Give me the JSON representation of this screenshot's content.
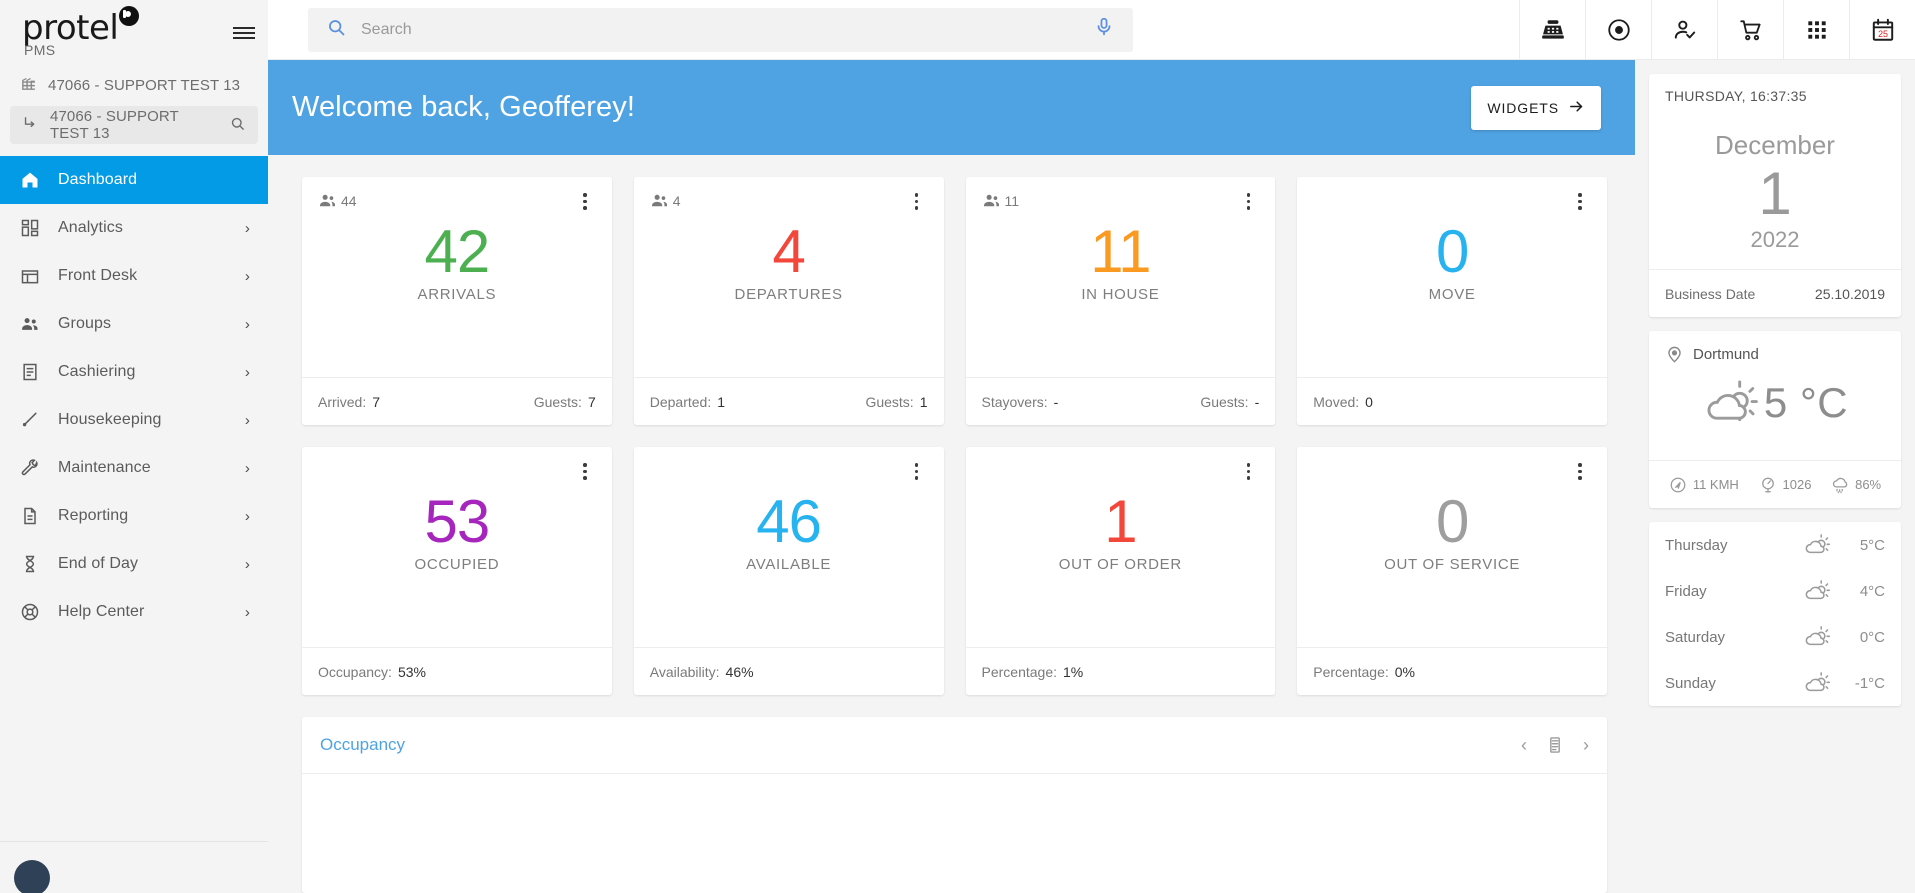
{
  "brand": {
    "name": "protel",
    "sub": "PMS",
    "dot_icon": "protel-mark-icon"
  },
  "property": {
    "parent": "47066 - SUPPORT TEST 13",
    "selected": "47066 - SUPPORT TEST 13"
  },
  "sidebar": {
    "items": [
      {
        "label": "Dashboard",
        "icon": "home-icon",
        "active": true,
        "chevron": ""
      },
      {
        "label": "Analytics",
        "icon": "dashboard-icon",
        "active": false,
        "chevron": "›"
      },
      {
        "label": "Front Desk",
        "icon": "store-icon",
        "active": false,
        "chevron": "›"
      },
      {
        "label": "Groups",
        "icon": "people-icon",
        "active": false,
        "chevron": "›"
      },
      {
        "label": "Cashiering",
        "icon": "receipt-icon",
        "active": false,
        "chevron": "›"
      },
      {
        "label": "Housekeeping",
        "icon": "brush-icon",
        "active": false,
        "chevron": "›"
      },
      {
        "label": "Maintenance",
        "icon": "wrench-icon",
        "active": false,
        "chevron": "›"
      },
      {
        "label": "Reporting",
        "icon": "document-icon",
        "active": false,
        "chevron": "›"
      },
      {
        "label": "End of Day",
        "icon": "hourglass-icon",
        "active": false,
        "chevron": "›"
      },
      {
        "label": "Help Center",
        "icon": "help-icon",
        "active": false,
        "chevron": "›"
      }
    ]
  },
  "topbar": {
    "search_placeholder": "Search",
    "search_value": "",
    "icons": [
      "cash-register-icon",
      "record-dot-icon",
      "person-check-icon",
      "shopping-cart-icon",
      "apps-grid-icon",
      "calendar-25-icon"
    ],
    "calendar_day": "25"
  },
  "welcome": {
    "greeting": "Welcome back, Geofferey!",
    "widgets_label": "WIDGETS",
    "accent": "#4fa3e3"
  },
  "kpis": [
    {
      "guests_badge": "44",
      "value": "42",
      "label": "ARRIVALS",
      "color": "#4caf50",
      "foot_left_label": "Arrived:",
      "foot_left_value": "7",
      "foot_right_label": "Guests:",
      "foot_right_value": "7"
    },
    {
      "guests_badge": "4",
      "value": "4",
      "label": "DEPARTURES",
      "color": "#f4473b",
      "foot_left_label": "Departed:",
      "foot_left_value": "1",
      "foot_right_label": "Guests:",
      "foot_right_value": "1"
    },
    {
      "guests_badge": "11",
      "value": "11",
      "label": "IN HOUSE",
      "color": "#fb9a21",
      "foot_left_label": "Stayovers:",
      "foot_left_value": "-",
      "foot_right_label": "Guests:",
      "foot_right_value": "-"
    },
    {
      "guests_badge": "",
      "value": "0",
      "label": "MOVE",
      "color": "#27b3f0",
      "foot_left_label": "Moved:",
      "foot_left_value": "0",
      "foot_right_label": "",
      "foot_right_value": ""
    },
    {
      "guests_badge": "",
      "value": "53",
      "label": "OCCUPIED",
      "color": "#a626bd",
      "foot_left_label": "Occupancy:",
      "foot_left_value": "53%",
      "foot_right_label": "",
      "foot_right_value": ""
    },
    {
      "guests_badge": "",
      "value": "46",
      "label": "AVAILABLE",
      "color": "#27b3f0",
      "foot_left_label": "Availability:",
      "foot_left_value": "46%",
      "foot_right_label": "",
      "foot_right_value": ""
    },
    {
      "guests_badge": "",
      "value": "1",
      "label": "OUT OF ORDER",
      "color": "#f4473b",
      "foot_left_label": "Percentage:",
      "foot_left_value": "1%",
      "foot_right_label": "",
      "foot_right_value": ""
    },
    {
      "guests_badge": "",
      "value": "0",
      "label": "OUT OF SERVICE",
      "color": "#9e9e9e",
      "foot_left_label": "Percentage:",
      "foot_left_value": "0%",
      "foot_right_label": "",
      "foot_right_value": ""
    }
  ],
  "occupancy_panel": {
    "title": "Occupancy",
    "prev": "‹",
    "next": "›",
    "calendar_icon": "calendar-icon"
  },
  "date_widget": {
    "weekday_time": "THURSDAY, 16:37:35",
    "month": "December",
    "day": "1",
    "year": "2022",
    "business_date_label": "Business Date",
    "business_date_value": "25.10.2019"
  },
  "weather": {
    "location": "Dortmund",
    "temperature": "5 °C",
    "condition_icon": "partly-cloudy-icon",
    "wind": "11 KMH",
    "pressure": "1026",
    "humidity": "86%",
    "forecast": [
      {
        "day": "Thursday",
        "icon": "partly-cloudy-icon",
        "temp": "5°C"
      },
      {
        "day": "Friday",
        "icon": "partly-cloudy-icon",
        "temp": "4°C"
      },
      {
        "day": "Saturday",
        "icon": "partly-cloudy-icon",
        "temp": "0°C"
      },
      {
        "day": "Sunday",
        "icon": "partly-cloudy-icon",
        "temp": "-1°C"
      }
    ]
  }
}
